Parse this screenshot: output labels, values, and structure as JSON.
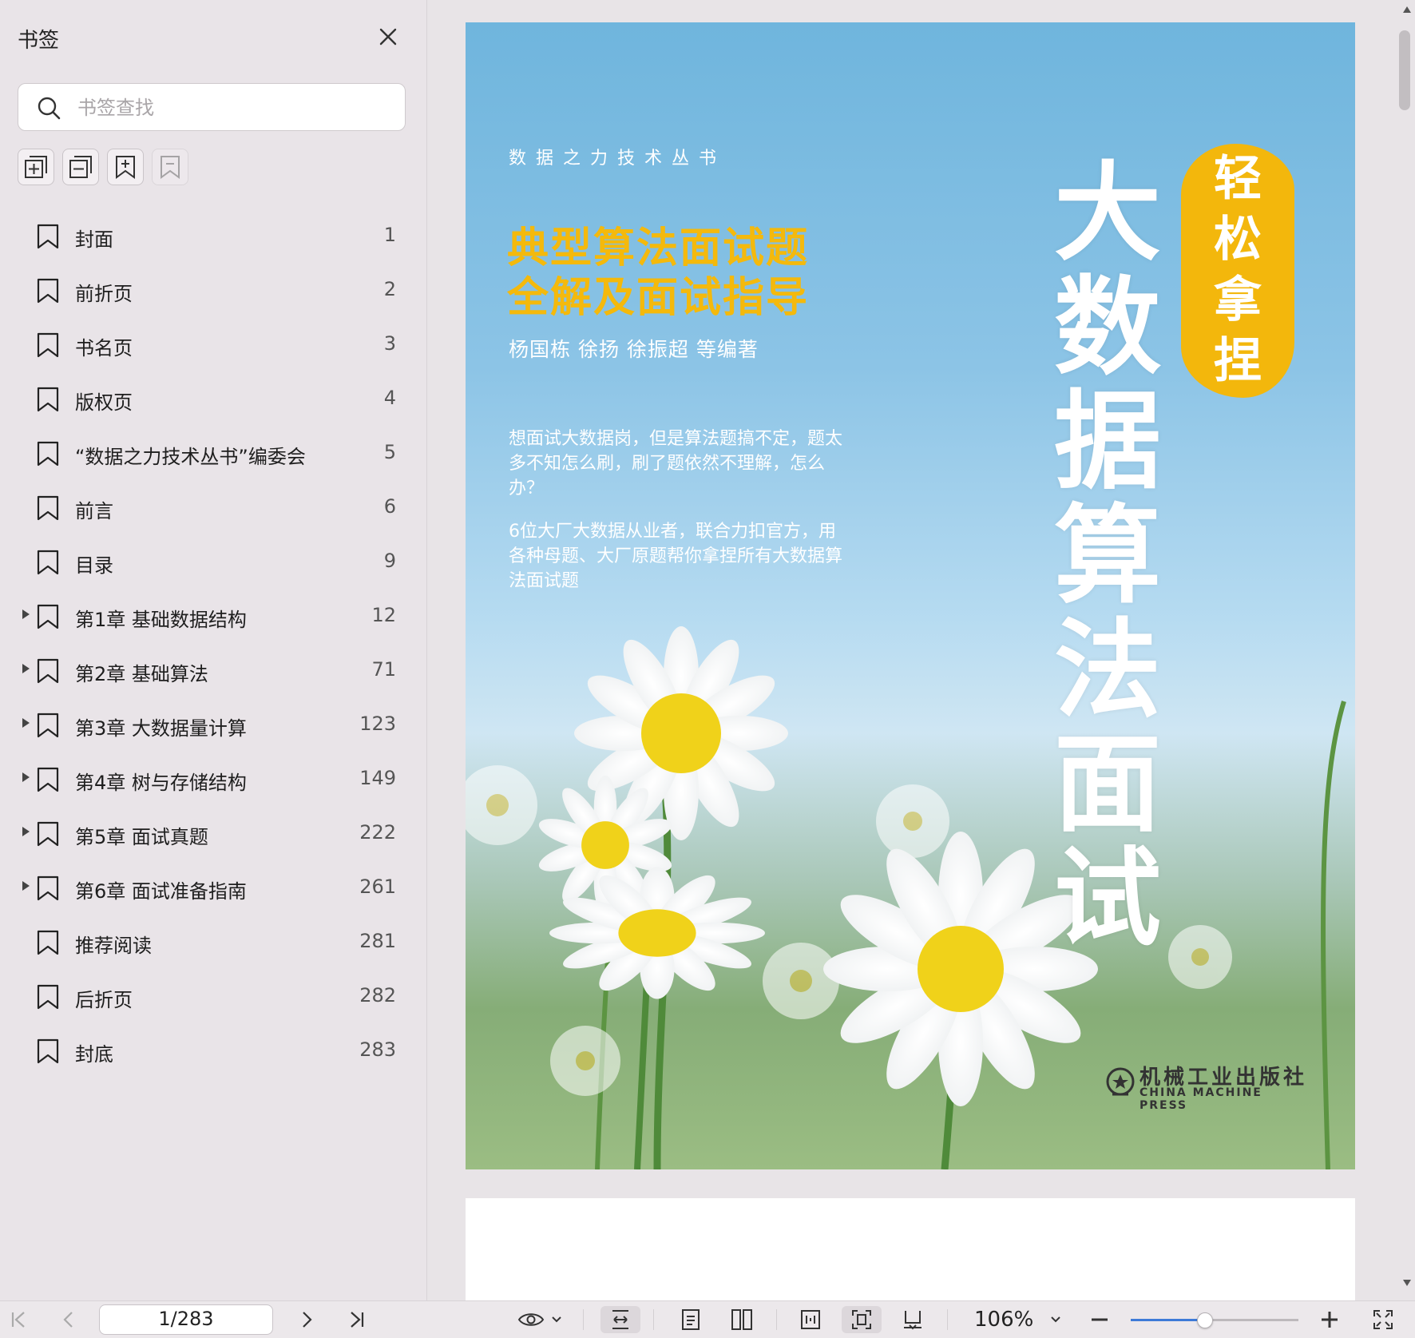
{
  "sidebar": {
    "title": "书签",
    "search_placeholder": "书签查找",
    "bookmarks": [
      {
        "label": "封面",
        "page": "1",
        "expandable": false
      },
      {
        "label": "前折页",
        "page": "2",
        "expandable": false
      },
      {
        "label": "书名页",
        "page": "3",
        "expandable": false
      },
      {
        "label": "版权页",
        "page": "4",
        "expandable": false
      },
      {
        "label": "“数据之力技术丛书”编委会",
        "page": "5",
        "expandable": false
      },
      {
        "label": "前言",
        "page": "6",
        "expandable": false
      },
      {
        "label": "目录",
        "page": "9",
        "expandable": false
      },
      {
        "label": "第1章 基础数据结构",
        "page": "12",
        "expandable": true
      },
      {
        "label": "第2章 基础算法",
        "page": "71",
        "expandable": true
      },
      {
        "label": "第3章 大数据量计算",
        "page": "123",
        "expandable": true
      },
      {
        "label": "第4章 树与存储结构",
        "page": "149",
        "expandable": true
      },
      {
        "label": "第5章 面试真题",
        "page": "222",
        "expandable": true
      },
      {
        "label": "第6章 面试准备指南",
        "page": "261",
        "expandable": true
      },
      {
        "label": "推荐阅读",
        "page": "281",
        "expandable": false
      },
      {
        "label": "后折页",
        "page": "282",
        "expandable": false
      },
      {
        "label": "封底",
        "page": "283",
        "expandable": false
      }
    ]
  },
  "cover": {
    "series": "数据之力技术丛书",
    "subtitle_line1": "典型算法面试题",
    "subtitle_line2": "全解及面试指导",
    "authors": "杨国栋  徐扬  徐振超  等编著",
    "blurb1": "想面试大数据岗，但是算法题搞不定，题太多不知怎么刷，刷了题依然不理解，怎么办？",
    "blurb2": "6位大厂大数据从业者，联合力扣官方，用各种母题、大厂原题帮你拿捏所有大数据算法面试题",
    "title_chars": [
      "大",
      "数",
      "据",
      "算",
      "法",
      "面",
      "试"
    ],
    "badge_chars": [
      "轻",
      "松",
      "拿",
      "捏"
    ],
    "publisher_cn": "机械工业出版社",
    "publisher_en": "CHINA MACHINE PRESS"
  },
  "toolbar": {
    "page_indicator": "1/283",
    "zoom": "106%",
    "zoom_slider_fraction": 0.44
  },
  "colors": {
    "accent": "#3d7ad8",
    "cover_yellow": "#f4b90c"
  }
}
